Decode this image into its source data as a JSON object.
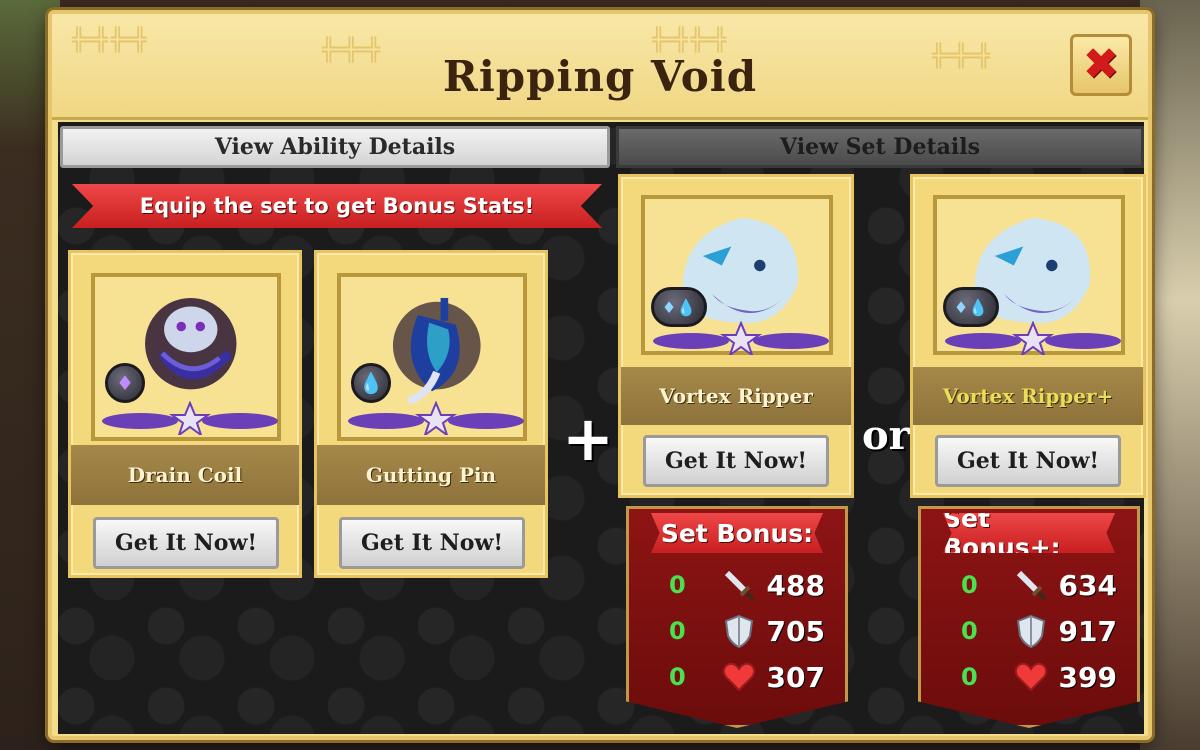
{
  "dialog": {
    "title": "Ripping Void",
    "close_label": "✖"
  },
  "tabs": {
    "ability_label": "View Ability Details",
    "set_label": "View Set Details",
    "active": "ability"
  },
  "banner": {
    "text": "Equip the set to get Bonus Stats!"
  },
  "items": [
    {
      "name": "Drain Coil",
      "element": "dark",
      "button": "Get It Now!"
    },
    {
      "name": "Gutting Pin",
      "element": "water",
      "button": "Get It Now!"
    }
  ],
  "connectors": {
    "plus": "+",
    "or": "or"
  },
  "sets": [
    {
      "name": "Vortex Ripper",
      "button": "Get It Now!",
      "bonus_title": "Set Bonus:",
      "stats": [
        {
          "current": "0",
          "icon": "sword-icon",
          "value": "488"
        },
        {
          "current": "0",
          "icon": "shield-icon",
          "value": "705"
        },
        {
          "current": "0",
          "icon": "heart-icon",
          "value": "307"
        }
      ]
    },
    {
      "name": "Vortex Ripper+",
      "button": "Get It Now!",
      "bonus_title": "Set Bonus+:",
      "stats": [
        {
          "current": "0",
          "icon": "sword-icon",
          "value": "634"
        },
        {
          "current": "0",
          "icon": "shield-icon",
          "value": "917"
        },
        {
          "current": "0",
          "icon": "heart-icon",
          "value": "399"
        }
      ]
    }
  ],
  "colors": {
    "panel_gold": "#f4d97c",
    "ribbon_red": "#d82a2a",
    "bonus_red": "#7d1010",
    "stat_green": "#49e24e",
    "plus_name_yellow": "#e9de56"
  }
}
